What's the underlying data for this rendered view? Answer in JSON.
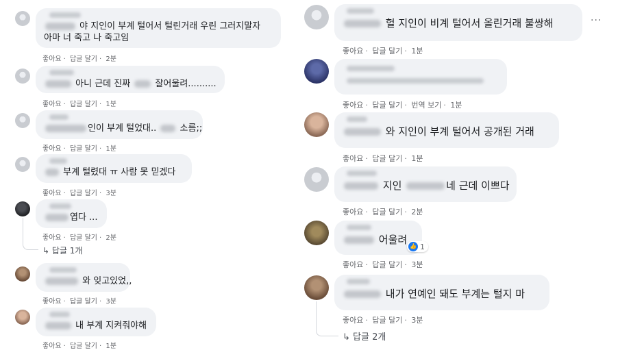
{
  "common": {
    "like": "좋아요",
    "reply": "답글 달기",
    "translate": "번역 보기",
    "sep": "·",
    "more": "···"
  },
  "left": [
    {
      "line1": "야 지인이 부계 털어서 털린거래 우린 그러지말자",
      "line2": "아마 너 죽고 나 죽고임",
      "time": "2분"
    },
    {
      "line1": "아니 근데 진짜",
      "line1b": "잘어울려..........",
      "time": "1분"
    },
    {
      "line1": "인이 부계 털었대..",
      "line1b": "소름;;",
      "time": "1분"
    },
    {
      "line1": "부계 털렸대 ㅠ 사람 못 믿겠다",
      "time": "3분"
    },
    {
      "line1": "엽다 ...",
      "time": "2분",
      "replies": "답글 1개"
    },
    {
      "line1": "와 잊고있었,,",
      "time": "3분"
    },
    {
      "line1": "내 부계 지켜줘야해",
      "time": "1분"
    }
  ],
  "right": [
    {
      "line1": "헐 지인이 비계 털어서 올린거래 불쌍해",
      "time": "1분"
    },
    {
      "line1": "",
      "time": "1분",
      "translate": true
    },
    {
      "line1": "와 지인이 부계 털어서 공개된 거래",
      "time": "1분"
    },
    {
      "line1": "지인",
      "line1b": "네 근데 이쁘다",
      "time": "2분"
    },
    {
      "line1": "어울려",
      "reactions": "1",
      "time": "3분"
    },
    {
      "line1": "내가 연예인 돼도 부계는 털지 마",
      "time": "3분",
      "replies": "답글 2개"
    }
  ]
}
